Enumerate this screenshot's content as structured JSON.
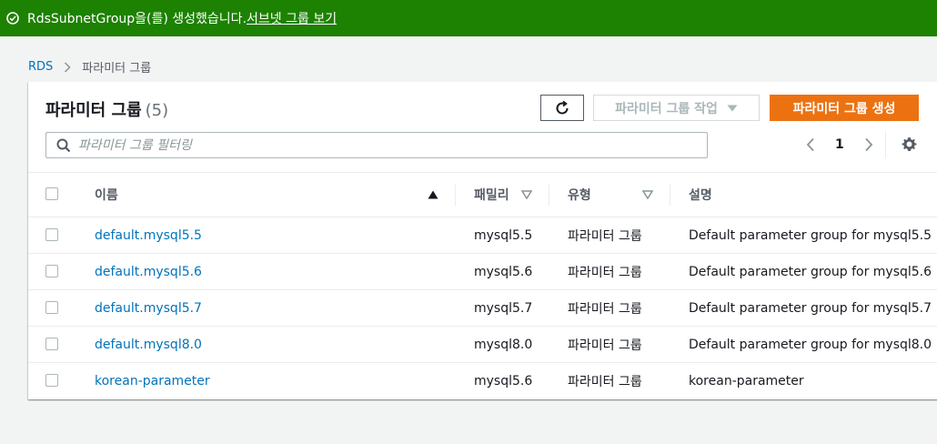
{
  "flash": {
    "message": "RdsSubnetGroup을(를) 생성했습니다.",
    "link": "서브넷 그룹 보기"
  },
  "breadcrumb": {
    "root": "RDS",
    "current": "파라미터 그룹"
  },
  "panel": {
    "title": "파라미터 그룹",
    "count": "(5)",
    "actions_label": "파라미터 그룹 작업",
    "create_label": "파라미터 그룹 생성",
    "search_placeholder": "파라미터 그룹 필터링",
    "page": "1"
  },
  "table": {
    "columns": {
      "name": "이름",
      "family": "패밀리",
      "type": "유형",
      "description": "설명"
    },
    "rows": [
      {
        "name": "default.mysql5.5",
        "family": "mysql5.5",
        "type": "파라미터 그룹",
        "description": "Default parameter group for mysql5.5"
      },
      {
        "name": "default.mysql5.6",
        "family": "mysql5.6",
        "type": "파라미터 그룹",
        "description": "Default parameter group for mysql5.6"
      },
      {
        "name": "default.mysql5.7",
        "family": "mysql5.7",
        "type": "파라미터 그룹",
        "description": "Default parameter group for mysql5.7"
      },
      {
        "name": "default.mysql8.0",
        "family": "mysql8.0",
        "type": "파라미터 그룹",
        "description": "Default parameter group for mysql8.0"
      },
      {
        "name": "korean-parameter",
        "family": "mysql5.6",
        "type": "파라미터 그룹",
        "description": "korean-parameter"
      }
    ]
  },
  "colors": {
    "success": "#1d8102",
    "primary": "#ec7211",
    "link": "#0073bb"
  },
  "icons": {
    "flash": "check-circle-icon",
    "breadcrumb_separator": "chevron-right-icon",
    "refresh": "refresh-icon",
    "actions": "caret-down-icon",
    "search": "search-icon",
    "prev": "chevron-left-icon",
    "next": "chevron-right-icon",
    "settings": "gear-icon",
    "sort_asc": "sort-ascending-icon",
    "sort": "sort-icon"
  }
}
